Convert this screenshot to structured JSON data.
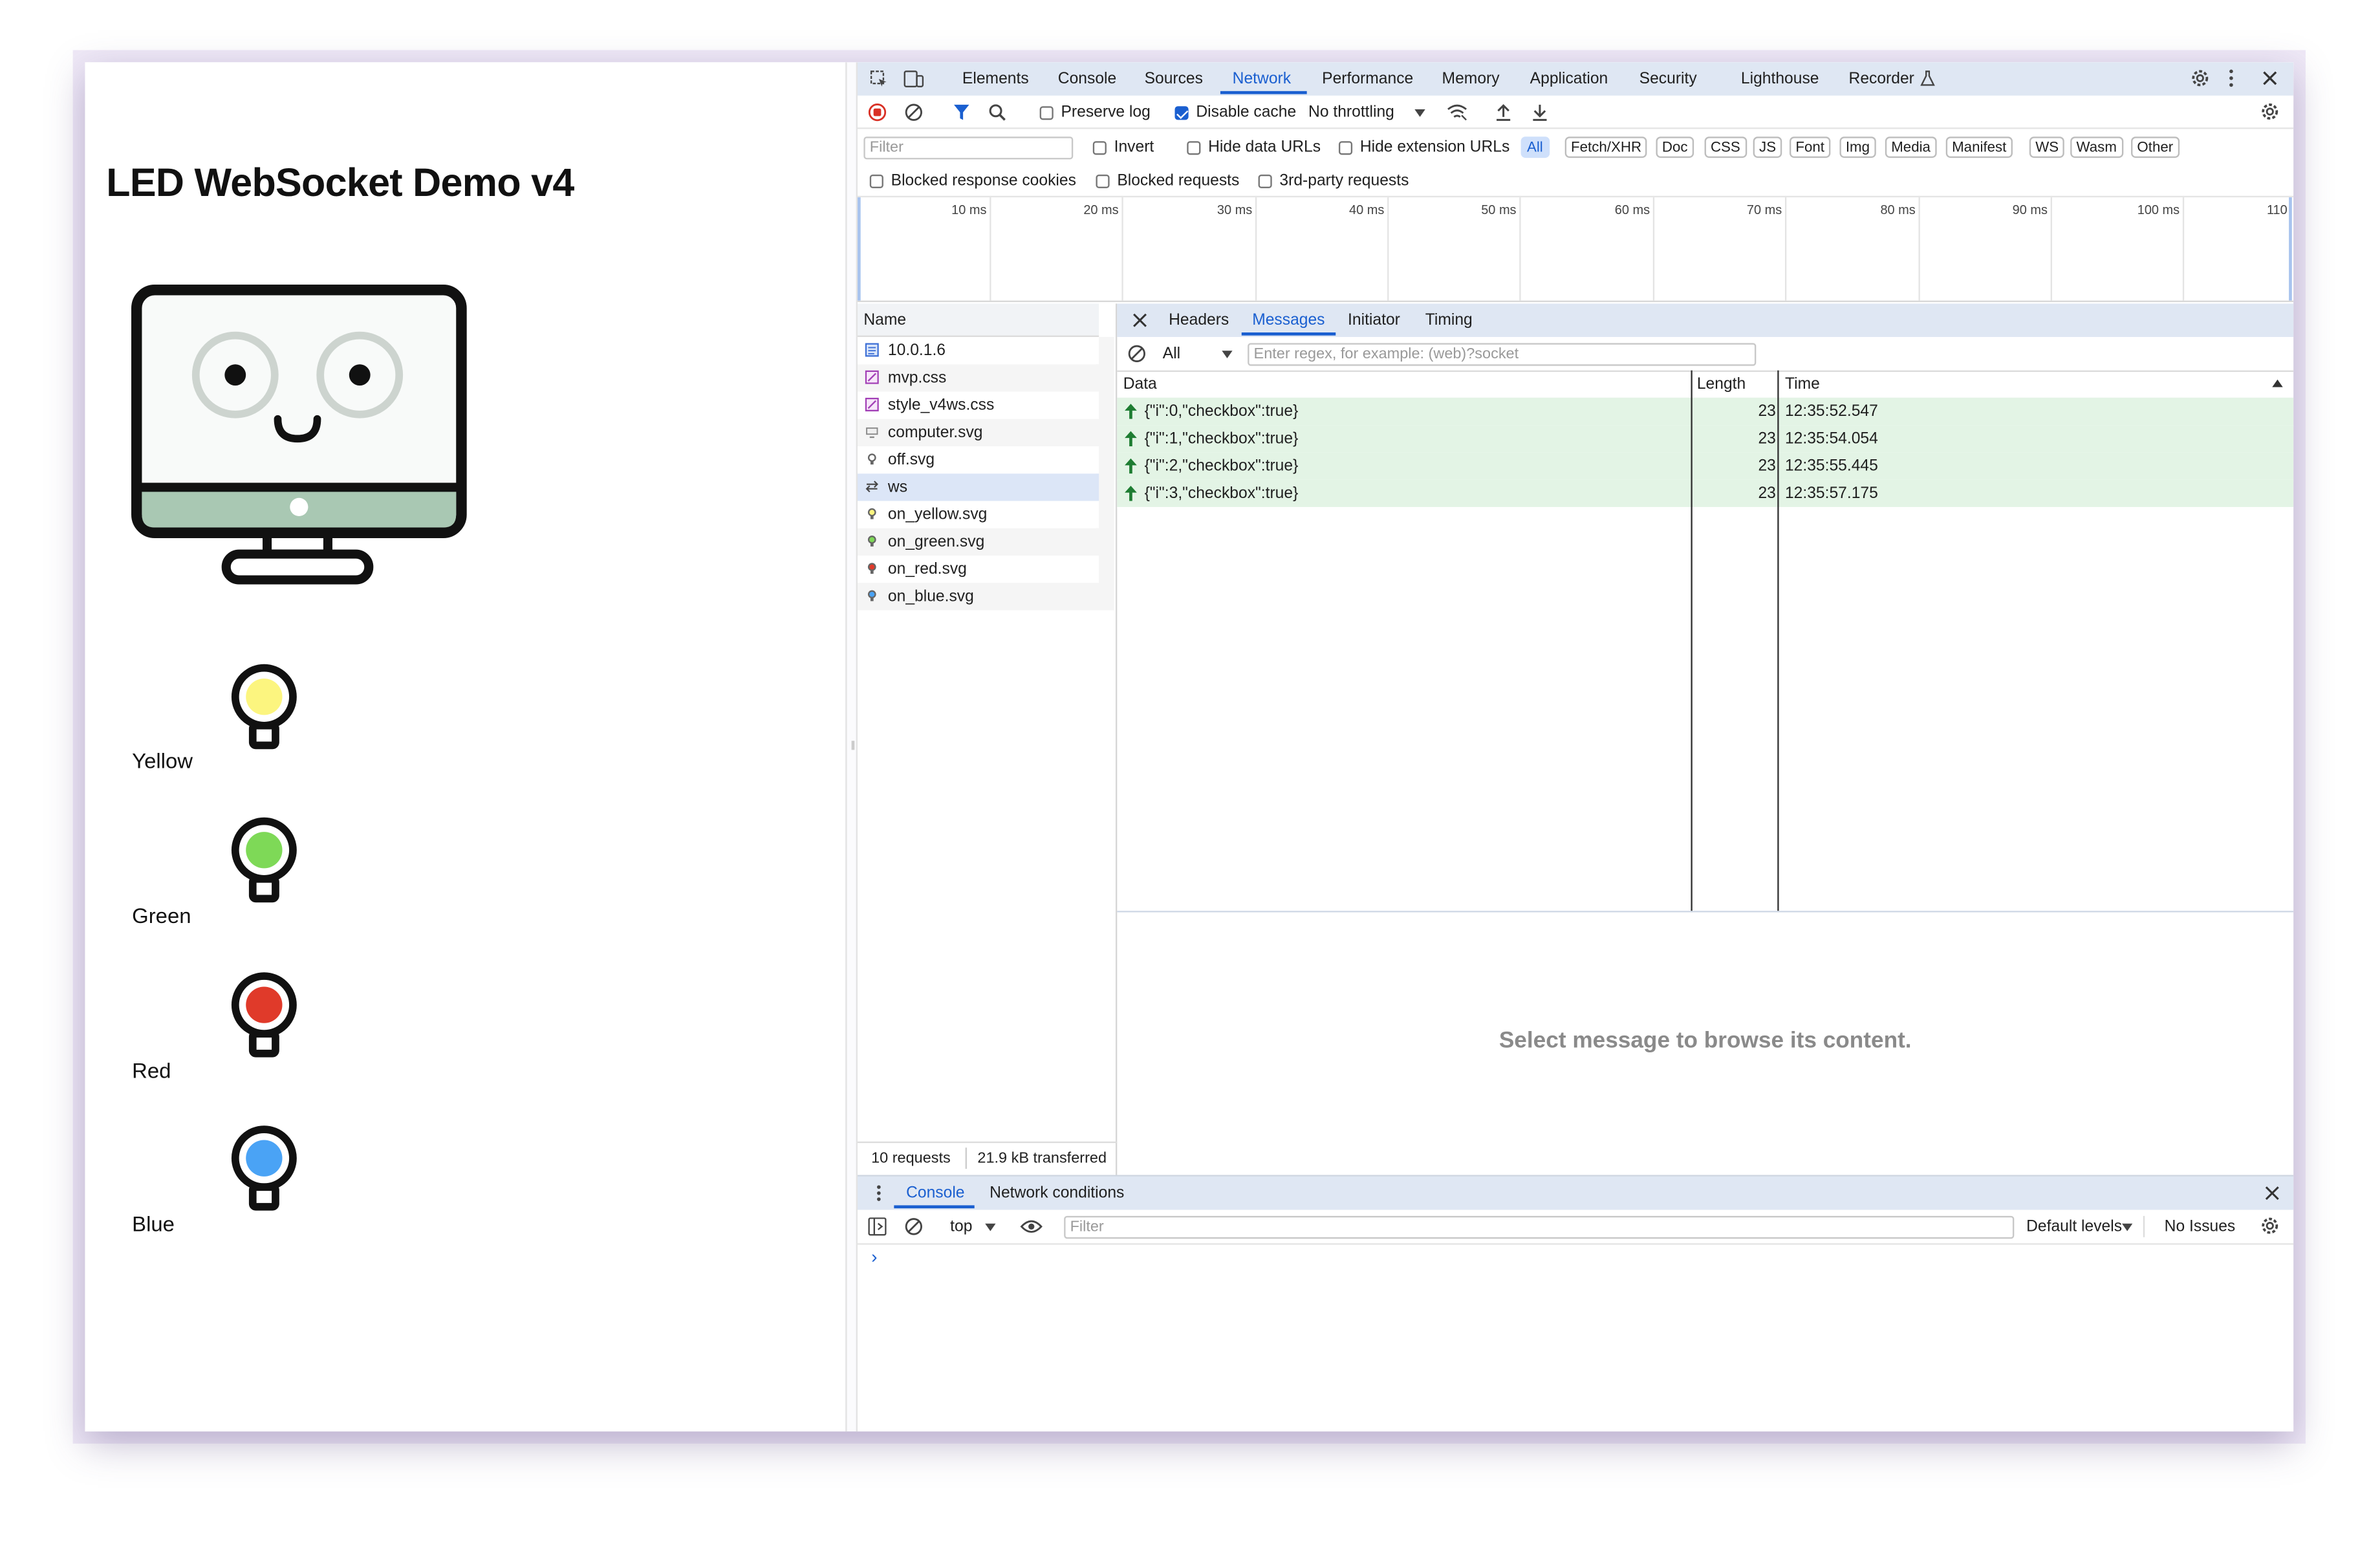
{
  "page": {
    "title": "LED WebSocket Demo v4",
    "leds": [
      {
        "label": "Yellow",
        "color": "#fcf57f"
      },
      {
        "label": "Green",
        "color": "#7ed957"
      },
      {
        "label": "Red",
        "color": "#e03a2a"
      },
      {
        "label": "Blue",
        "color": "#4aa3f5"
      }
    ]
  },
  "devtools": {
    "tabs": [
      "Elements",
      "Console",
      "Sources",
      "Network",
      "Performance",
      "Memory",
      "Application",
      "Security",
      "Lighthouse",
      "Recorder"
    ],
    "active_tab": "Network",
    "toolbar": {
      "preserve_log": "Preserve log",
      "disable_cache": "Disable cache",
      "throttling": "No throttling"
    },
    "filter": {
      "placeholder": "Filter",
      "invert": "Invert",
      "hide_data_urls": "Hide data URLs",
      "hide_extension_urls": "Hide extension URLs",
      "types": [
        "All",
        "Fetch/XHR",
        "Doc",
        "CSS",
        "JS",
        "Font",
        "Img",
        "Media",
        "Manifest",
        "WS",
        "Wasm",
        "Other"
      ]
    },
    "blocking": {
      "blocked_cookies": "Blocked response cookies",
      "blocked_requests": "Blocked requests",
      "third_party": "3rd-party requests"
    },
    "timeline_ticks": [
      "10 ms",
      "20 ms",
      "30 ms",
      "40 ms",
      "50 ms",
      "60 ms",
      "70 ms",
      "80 ms",
      "90 ms",
      "100 ms",
      "110"
    ],
    "requests": {
      "header": "Name",
      "items": [
        {
          "name": "10.0.1.6",
          "type": "doc"
        },
        {
          "name": "mvp.css",
          "type": "css"
        },
        {
          "name": "style_v4ws.css",
          "type": "css"
        },
        {
          "name": "computer.svg",
          "type": "img"
        },
        {
          "name": "off.svg",
          "type": "img"
        },
        {
          "name": "ws",
          "type": "ws"
        },
        {
          "name": "on_yellow.svg",
          "type": "img"
        },
        {
          "name": "on_green.svg",
          "type": "img"
        },
        {
          "name": "on_red.svg",
          "type": "img"
        },
        {
          "name": "on_blue.svg",
          "type": "img"
        }
      ],
      "footer_count": "10 requests",
      "footer_transferred": "21.9 kB transferred"
    },
    "detail": {
      "tabs": [
        "Headers",
        "Messages",
        "Initiator",
        "Timing"
      ],
      "active": "Messages",
      "message_filter": "All",
      "regex_placeholder": "Enter regex, for example: (web)?socket",
      "columns": {
        "data": "Data",
        "length": "Length",
        "time": "Time"
      },
      "messages": [
        {
          "data": "{\"i\":0,\"checkbox\":true}",
          "length": "23",
          "time": "12:35:52.547"
        },
        {
          "data": "{\"i\":1,\"checkbox\":true}",
          "length": "23",
          "time": "12:35:54.054"
        },
        {
          "data": "{\"i\":2,\"checkbox\":true}",
          "length": "23",
          "time": "12:35:55.445"
        },
        {
          "data": "{\"i\":3,\"checkbox\":true}",
          "length": "23",
          "time": "12:35:57.175"
        }
      ],
      "placeholder": "Select message to browse its content."
    },
    "drawer": {
      "tabs": [
        "Console",
        "Network conditions"
      ],
      "context": "top",
      "filter_placeholder": "Filter",
      "levels": "Default levels",
      "issues": "No Issues",
      "prompt": "›"
    }
  }
}
